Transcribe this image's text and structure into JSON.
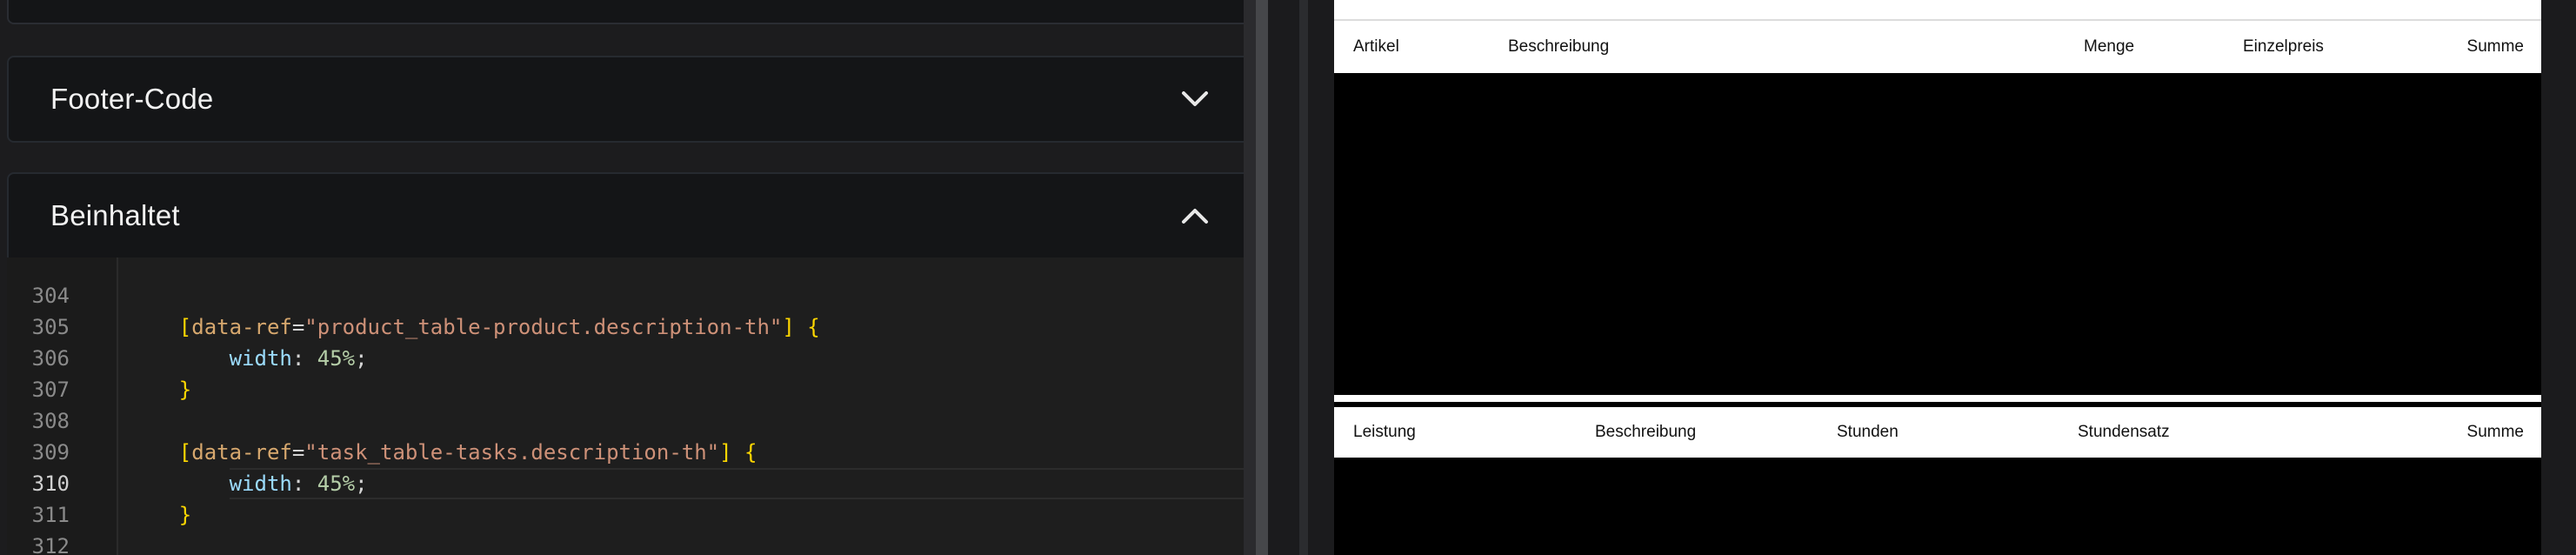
{
  "editor": {
    "panels": {
      "footer": {
        "title": "Footer-Code",
        "state": "collapsed",
        "icon": "chevron-down-icon"
      },
      "contains": {
        "title": "Beinhaltet",
        "state": "expanded",
        "icon": "chevron-up-icon"
      }
    },
    "lines": [
      {
        "number": "304",
        "code": ""
      },
      {
        "number": "305",
        "code": "    [data-ref=\"product_table-product.description-th\"] {"
      },
      {
        "number": "306",
        "code": "        width: 45%;"
      },
      {
        "number": "307",
        "code": "    }"
      },
      {
        "number": "308",
        "code": ""
      },
      {
        "number": "309",
        "code": "    [data-ref=\"task_table-tasks.description-th\"] {"
      },
      {
        "number": "310",
        "code": "        width: 45%;",
        "active": true
      },
      {
        "number": "311",
        "code": "    }"
      },
      {
        "number": "312",
        "code": ""
      }
    ]
  },
  "preview": {
    "product_table": {
      "headers": [
        "Artikel",
        "Beschreibung",
        "Menge",
        "Einzelpreis",
        "Summe"
      ]
    },
    "task_table": {
      "headers": [
        "Leistung",
        "Beschreibung",
        "Stunden",
        "Stundensatz",
        "Summe"
      ]
    }
  },
  "colors": {
    "editor_bg": "#1e1e1e",
    "panel_bg": "#141517",
    "bracket": "#ffd700",
    "string": "#ce9178",
    "property": "#9cdcfe",
    "number": "#b5cea8"
  }
}
